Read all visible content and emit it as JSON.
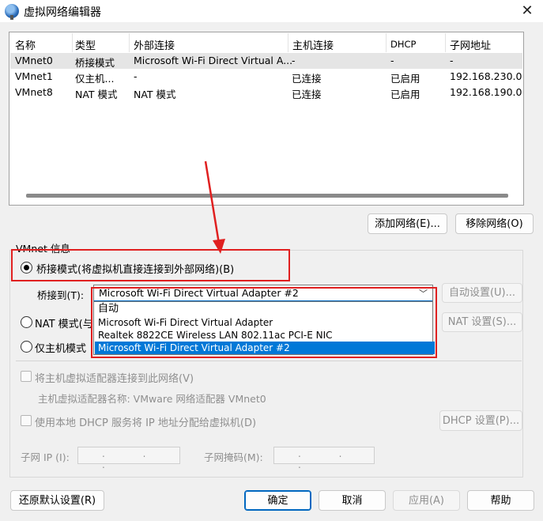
{
  "window": {
    "title": "虚拟网络编辑器",
    "close_glyph": "✕"
  },
  "list": {
    "headers": [
      "名称",
      "类型",
      "外部连接",
      "主机连接",
      "DHCP",
      "子网地址"
    ],
    "rows": [
      [
        "VMnet0",
        "桥接模式",
        "Microsoft Wi-Fi Direct Virtual A...",
        "-",
        "-",
        "-"
      ],
      [
        "VMnet1",
        "仅主机...",
        "-",
        "已连接",
        "已启用",
        "192.168.230.0"
      ],
      [
        "VMnet8",
        "NAT 模式",
        "NAT 模式",
        "已连接",
        "已启用",
        "192.168.190.0"
      ]
    ],
    "selected_row": 0
  },
  "buttons": {
    "add_network": "添加网络(E)...",
    "remove_network": "移除网络(O)",
    "auto_settings": "自动设置(U)...",
    "nat_settings": "NAT 设置(S)...",
    "dhcp_settings": "DHCP 设置(P)...",
    "restore_defaults": "还原默认设置(R)",
    "ok": "确定",
    "cancel": "取消",
    "apply": "应用(A)",
    "help": "帮助"
  },
  "vmnet_info": {
    "group_title": "VMnet 信息",
    "bridged_radio": "桥接模式(将虚拟机直接连接到外部网络)(B)",
    "bridge_to_label": "桥接到(T):",
    "bridge_to_value": "Microsoft Wi-Fi Direct Virtual Adapter #2",
    "dropdown_options": [
      "自动",
      "Microsoft Wi-Fi Direct Virtual Adapter",
      "Realtek 8822CE Wireless LAN 802.11ac PCI-E NIC",
      "Microsoft Wi-Fi Direct Virtual Adapter #2"
    ],
    "dropdown_selected": 3,
    "nat_radio": "NAT 模式(与",
    "hostonly_radio": "仅主机模式",
    "connect_host_adapter": "将主机虚拟适配器连接到此网络(V)",
    "host_adapter_name": "主机虚拟适配器名称: VMware 网络适配器 VMnet0",
    "use_local_dhcp": "使用本地 DHCP 服务将 IP 地址分配给虚拟机(D)",
    "subnet_ip_label": "子网 IP (I):",
    "subnet_mask_label": "子网掩码(M):",
    "ip_dots": ". . .",
    "mask_dots": ". . ."
  },
  "colors": {
    "annotation_red": "#e02020",
    "selection_blue": "#0078d7",
    "primary_border": "#0067c0"
  }
}
